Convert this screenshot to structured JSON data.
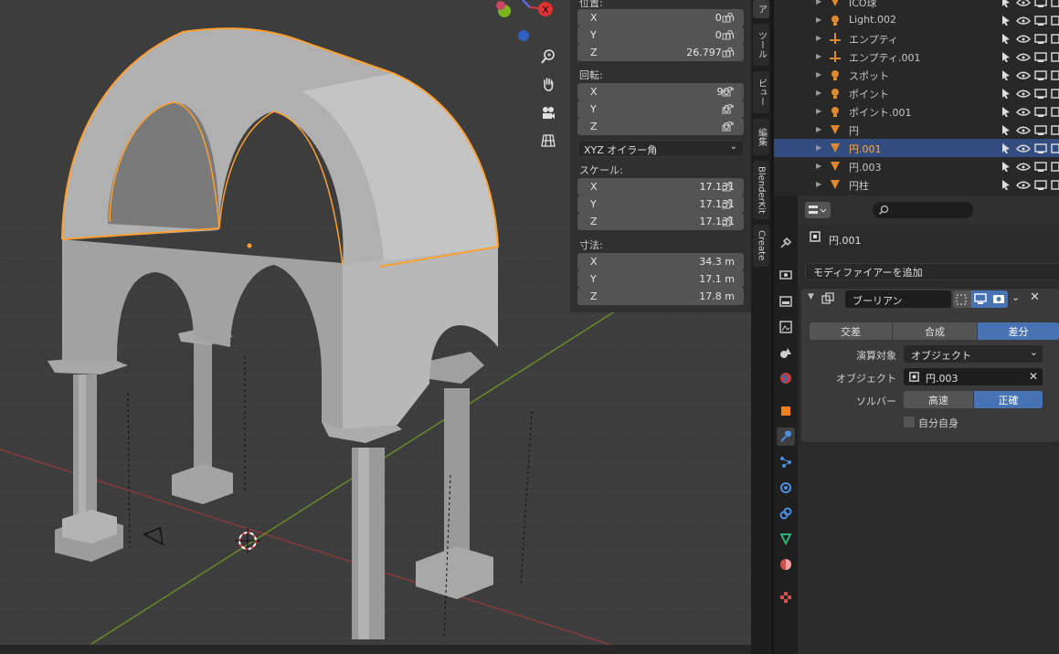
{
  "viewport": {
    "gizmo_axis": "X"
  },
  "npanel": {
    "location_label": "位置:",
    "location": [
      {
        "axis": "X",
        "value": "0 m"
      },
      {
        "axis": "Y",
        "value": "0 m"
      },
      {
        "axis": "Z",
        "value": "26.797 m"
      }
    ],
    "rotation_label": "回転:",
    "rotation": [
      {
        "axis": "X",
        "value": "90°"
      },
      {
        "axis": "Y",
        "value": "0°"
      },
      {
        "axis": "Z",
        "value": "0°"
      }
    ],
    "rotation_mode": "XYZ オイラー角",
    "scale_label": "スケール:",
    "scale": [
      {
        "axis": "X",
        "value": "17.131"
      },
      {
        "axis": "Y",
        "value": "17.131"
      },
      {
        "axis": "Z",
        "value": "17.131"
      }
    ],
    "dimensions_label": "寸法:",
    "dimensions": [
      {
        "axis": "X",
        "value": "34.3 m"
      },
      {
        "axis": "Y",
        "value": "17.1 m"
      },
      {
        "axis": "Z",
        "value": "17.8 m"
      }
    ]
  },
  "side_tabs": [
    "ア",
    "ツール",
    "ビュー",
    "編集",
    "BlenderKit",
    "Create"
  ],
  "outliner": {
    "rows": [
      {
        "name": "ICO球",
        "type": "mesh"
      },
      {
        "name": "Light.002",
        "type": "light"
      },
      {
        "name": "エンプティ",
        "type": "empty"
      },
      {
        "name": "エンプティ.001",
        "type": "empty"
      },
      {
        "name": "スポット",
        "type": "light"
      },
      {
        "name": "ポイント",
        "type": "light"
      },
      {
        "name": "ポイント.001",
        "type": "light"
      },
      {
        "name": "円",
        "type": "mesh"
      },
      {
        "name": "円.001",
        "type": "mesh"
      },
      {
        "name": "円.003",
        "type": "mesh"
      },
      {
        "name": "円柱",
        "type": "mesh"
      }
    ]
  },
  "properties": {
    "object_name": "円.001",
    "add_modifier": "モディファイアーを追加",
    "modifier_name": "ブーリアン",
    "ops": [
      "交差",
      "合成",
      "差分"
    ],
    "operand_label": "演算対象",
    "operand_value": "オブジェクト",
    "object_label": "オブジェクト",
    "object_value": "円.003",
    "solver_label": "ソルバー",
    "solver_fast": "高速",
    "solver_exact": "正確",
    "self_label": "自分自身"
  },
  "colors": {
    "accent": "#4772b3",
    "selection_orange": "#ffa030",
    "active_row": "#334d80"
  }
}
